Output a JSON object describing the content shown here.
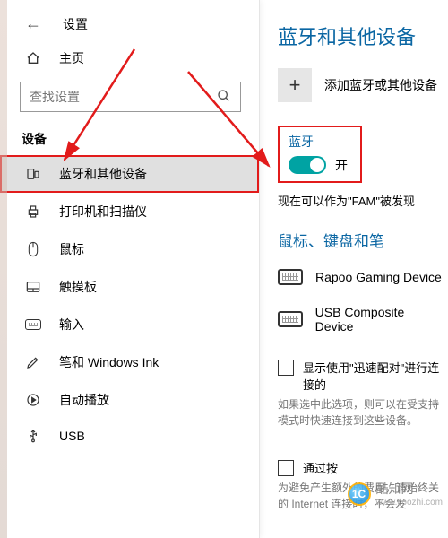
{
  "header": {
    "back_title": "设置",
    "home_label": "主页",
    "search_placeholder": "查找设置"
  },
  "sidebar": {
    "section_label": "设备",
    "items": [
      {
        "icon": "bluetooth",
        "label": "蓝牙和其他设备",
        "selected": true
      },
      {
        "icon": "printer",
        "label": "打印机和扫描仪"
      },
      {
        "icon": "mouse",
        "label": "鼠标"
      },
      {
        "icon": "touchpad",
        "label": "触摸板"
      },
      {
        "icon": "keyboard",
        "label": "输入"
      },
      {
        "icon": "pen",
        "label": "笔和 Windows Ink"
      },
      {
        "icon": "autoplay",
        "label": "自动播放"
      },
      {
        "icon": "usb",
        "label": "USB"
      }
    ]
  },
  "main": {
    "title": "蓝牙和其他设备",
    "add_label": "添加蓝牙或其他设备",
    "bluetooth": {
      "label": "蓝牙",
      "state_label": "开",
      "on": true
    },
    "discoverable_text": "现在可以作为\"FAM\"被发现",
    "group_title": "鼠标、键盘和笔",
    "devices": [
      {
        "name": "Rapoo Gaming Device"
      },
      {
        "name": "USB Composite Device"
      }
    ],
    "swift_pair": {
      "label": "显示使用\"迅速配对\"进行连接的",
      "desc": "如果选中此选项，则可以在受支持模式时快速连接到这些设备。"
    },
    "metered": {
      "label": "通过按",
      "desc": "为避免产生额外的费用，请始终关的 Internet 连接时，不会发"
    }
  },
  "watermark": {
    "site": "酷知网",
    "url": "www.coozhi.com",
    "badge": "1C"
  },
  "colors": {
    "accent": "#00a3a3",
    "link": "#0a66a3",
    "highlight": "#e21b1b"
  }
}
